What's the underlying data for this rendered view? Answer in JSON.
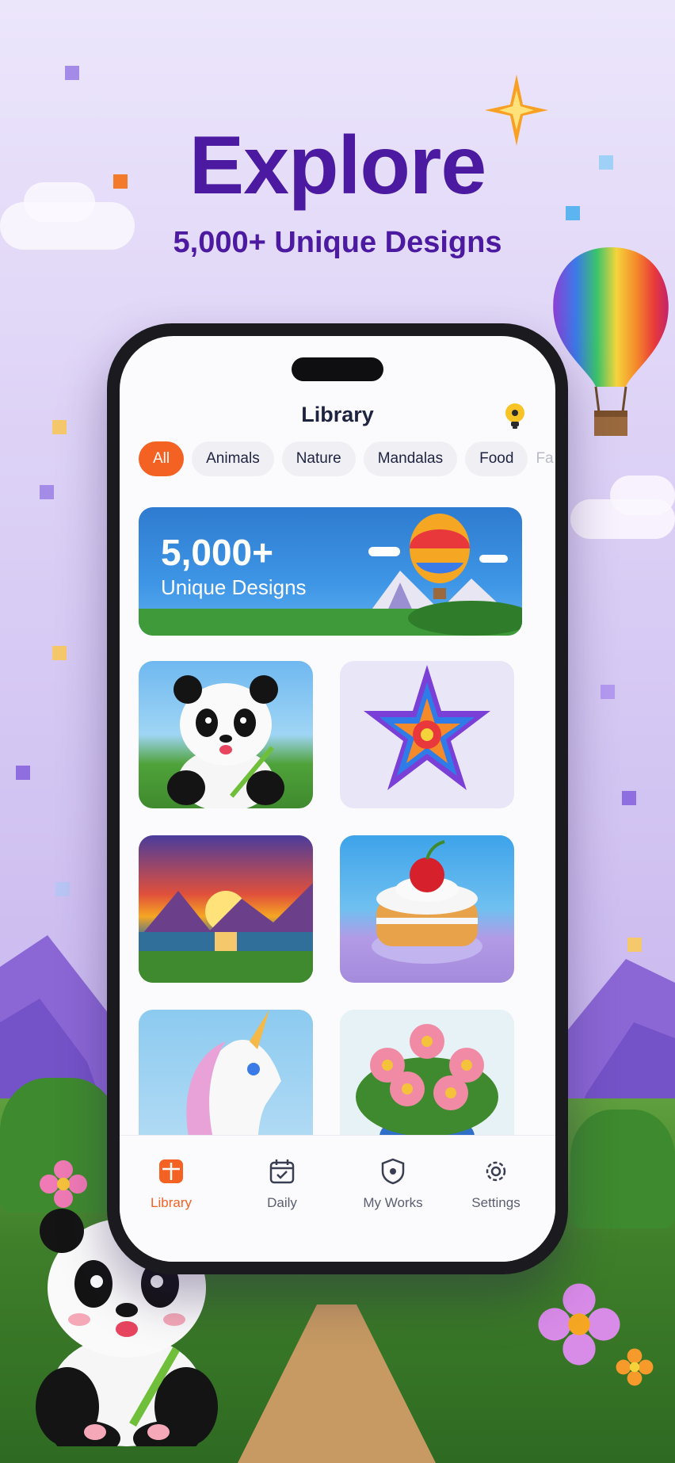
{
  "hero": {
    "title": "Explore",
    "subtitle": "5,000+ Unique Designs"
  },
  "app": {
    "title": "Library",
    "hint_icon": "lightbulb-icon",
    "categories": [
      {
        "label": "All",
        "active": true
      },
      {
        "label": "Animals",
        "active": false
      },
      {
        "label": "Nature",
        "active": false
      },
      {
        "label": "Mandalas",
        "active": false
      },
      {
        "label": "Food",
        "active": false
      },
      {
        "label": "Fa",
        "active": false
      }
    ],
    "banner": {
      "number": "5,000+",
      "text": "Unique Designs"
    },
    "tiles": [
      {
        "name": "panda-artwork"
      },
      {
        "name": "mandala-artwork"
      },
      {
        "name": "sunset-artwork"
      },
      {
        "name": "cake-artwork"
      },
      {
        "name": "unicorn-artwork"
      },
      {
        "name": "flowers-artwork"
      }
    ],
    "tabs": [
      {
        "label": "Library",
        "icon": "library-icon",
        "active": true
      },
      {
        "label": "Daily",
        "icon": "calendar-icon",
        "active": false
      },
      {
        "label": "My Works",
        "icon": "shield-icon",
        "active": false
      },
      {
        "label": "Settings",
        "icon": "gear-icon",
        "active": false
      }
    ]
  },
  "colors": {
    "accent": "#f46223",
    "hero_text": "#4b1aa0",
    "background": "#ddd2f6"
  }
}
